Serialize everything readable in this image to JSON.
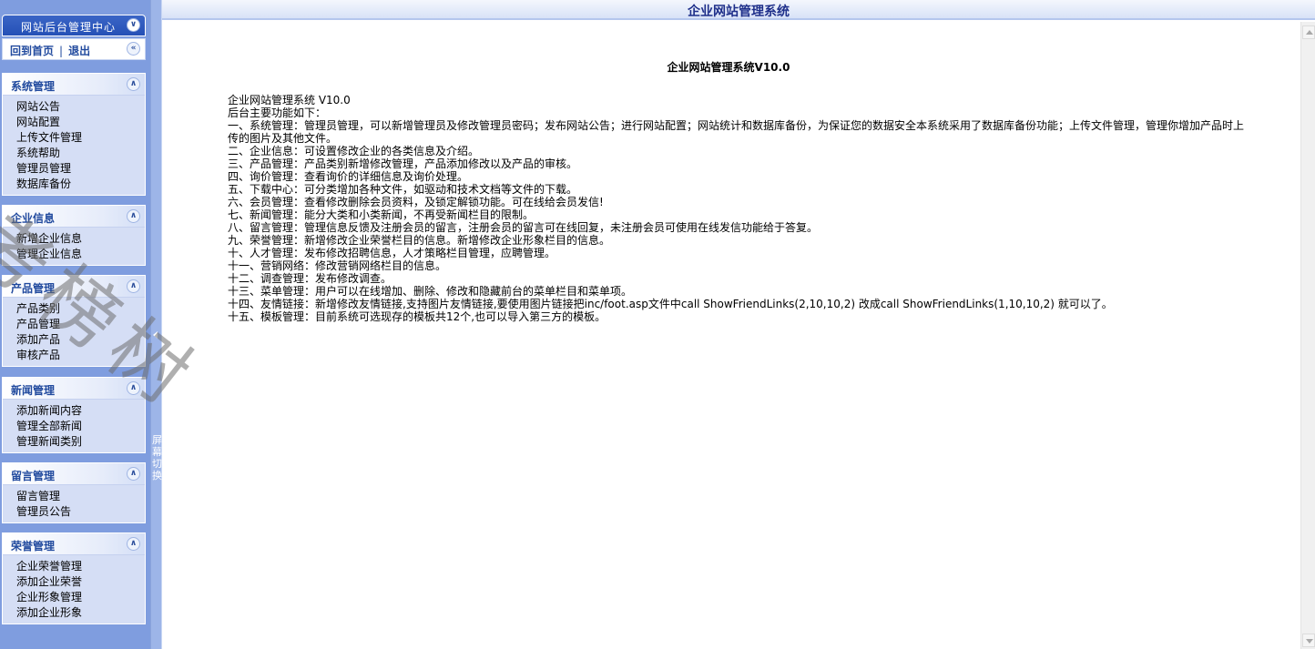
{
  "sidebar": {
    "header_title": "网站后台管理中心",
    "links": {
      "home": "回到首页",
      "separator": "|",
      "logout": "退出"
    },
    "menus": [
      {
        "title": "系统管理",
        "items": [
          "网站公告",
          "网站配置",
          "上传文件管理",
          "系统帮助",
          "管理员管理",
          "数据库备份"
        ]
      },
      {
        "title": "企业信息",
        "items": [
          "新增企业信息",
          "管理企业信息"
        ]
      },
      {
        "title": "产品管理",
        "items": [
          "产品类别",
          "产品管理",
          "添加产品",
          "审核产品"
        ]
      },
      {
        "title": "新闻管理",
        "items": [
          "添加新闻内容",
          "管理全部新闻",
          "管理新闻类别"
        ]
      },
      {
        "title": "留言管理",
        "items": [
          "留言管理",
          "管理员公告"
        ]
      },
      {
        "title": "荣誉管理",
        "items": [
          "企业荣誉管理",
          "添加企业荣誉",
          "企业形象管理",
          "添加企业形象"
        ]
      }
    ]
  },
  "splitter": {
    "toggle_label": "屏幕切换"
  },
  "topbar": {
    "title": "企业网站管理系统"
  },
  "content": {
    "title": "企业网站管理系统V10.0",
    "lines": [
      "企业网站管理系统 V10.0",
      "后台主要功能如下：",
      "一、系统管理：管理员管理，可以新增管理员及修改管理员密码；发布网站公告；进行网站配置；网站统计和数据库备份，为保证您的数据安全本系统采用了数据库备份功能；上传文件管理，管理你增加产品时上传的图片及其他文件。",
      "二、企业信息：可设置修改企业的各类信息及介绍。",
      "三、产品管理：产品类别新增修改管理，产品添加修改以及产品的审核。",
      "四、询价管理：查看询价的详细信息及询价处理。",
      "五、下载中心：可分类增加各种文件，如驱动和技术文档等文件的下载。",
      "六、会员管理：查看修改删除会员资料，及锁定解锁功能。可在线给会员发信!",
      "七、新闻管理：能分大类和小类新闻，不再受新闻栏目的限制。",
      "八、留言管理：管理信息反馈及注册会员的留言，注册会员的留言可在线回复，未注册会员可使用在线发信功能给于答复。",
      "九、荣誉管理：新增修改企业荣誉栏目的信息。新增修改企业形象栏目的信息。",
      "十、人才管理：发布修改招聘信息，人才策略栏目管理，应聘管理。",
      "十一、营销网络：修改营销网络栏目的信息。",
      "十二、调查管理：发布修改调查。",
      "十三、菜单管理：用户可以在线增加、删除、修改和隐藏前台的菜单栏目和菜单项。",
      "十四、友情链接：新增修改友情链接,支持图片友情链接,要使用图片链接把inc/foot.asp文件中call ShowFriendLinks(2,10,10,2) 改成call ShowFriendLinks(1,10,10,2) 就可以了。",
      "十五、模板管理：目前系统可选现存的模板共12个,也可以导入第三方的模板。"
    ]
  },
  "watermark": "考榜树"
}
